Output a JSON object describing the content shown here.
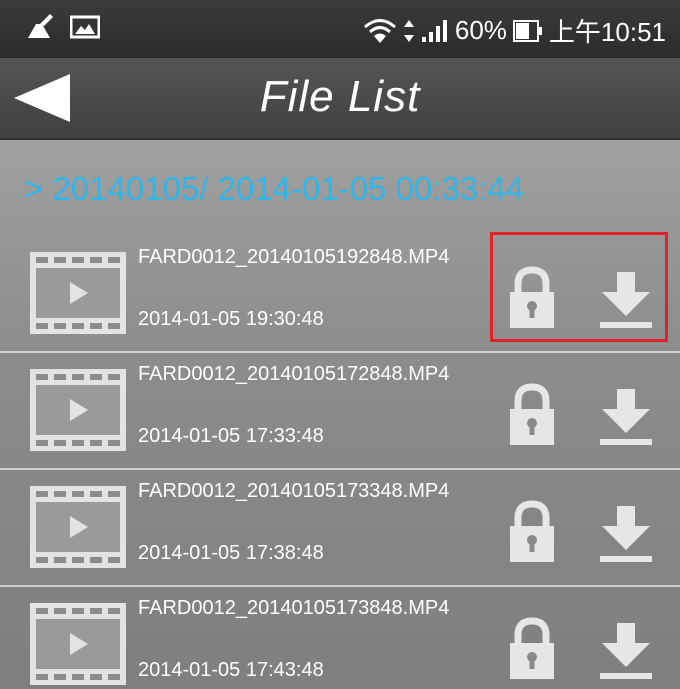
{
  "status_bar": {
    "battery": "60%",
    "time": "上午10:51",
    "icons": [
      "cleaner-icon",
      "image-icon",
      "wifi-icon",
      "data-arrows-icon",
      "signal-icon",
      "battery-icon"
    ]
  },
  "header": {
    "back_icon": "back-arrow-icon",
    "title": "File List"
  },
  "folder": {
    "path": "> 20140105/ 2014-01-05 00:33:44"
  },
  "files": [
    {
      "name": "FARD0012_20140105192848.MP4",
      "date": "2014-01-05 19:30:48",
      "highlighted": true
    },
    {
      "name": "FARD0012_20140105172848.MP4",
      "date": "2014-01-05 17:33:48",
      "highlighted": false
    },
    {
      "name": "FARD0012_20140105173348.MP4",
      "date": "2014-01-05 17:38:48",
      "highlighted": false
    },
    {
      "name": "FARD0012_20140105173848.MP4",
      "date": "2014-01-05 17:43:48",
      "highlighted": false
    }
  ],
  "colors": {
    "accent": "#2fb7ea",
    "highlight": "#e0222a",
    "icon": "#e6e6e6"
  }
}
